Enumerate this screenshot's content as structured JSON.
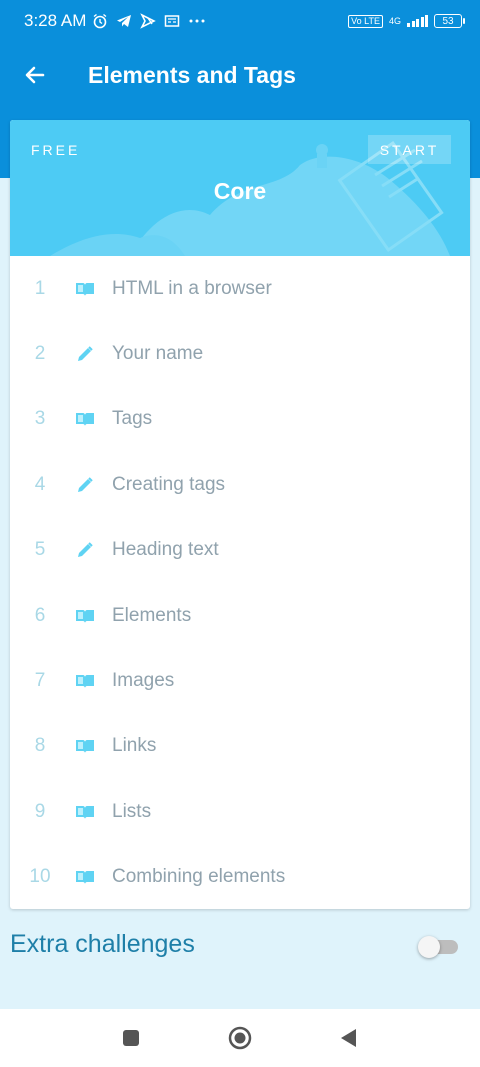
{
  "status": {
    "time": "3:28 AM",
    "icons": [
      "alarm-icon",
      "telegram-icon",
      "telegram-x-icon",
      "news-icon",
      "more-icon"
    ],
    "network_badge": "Vo LTE",
    "network_type": "4G",
    "battery": "53"
  },
  "appbar": {
    "title": "Elements and Tags",
    "back_icon": "arrow-left-icon"
  },
  "course": {
    "tag": "FREE",
    "start_label": "START",
    "title": "Core",
    "lessons": [
      {
        "num": "1",
        "label": "HTML in a browser",
        "icon": "book-icon"
      },
      {
        "num": "2",
        "label": "Your name",
        "icon": "pencil-icon"
      },
      {
        "num": "3",
        "label": "Tags",
        "icon": "book-icon"
      },
      {
        "num": "4",
        "label": "Creating tags",
        "icon": "pencil-icon"
      },
      {
        "num": "5",
        "label": "Heading text",
        "icon": "pencil-icon"
      },
      {
        "num": "6",
        "label": "Elements",
        "icon": "book-icon"
      },
      {
        "num": "7",
        "label": "Images",
        "icon": "book-icon"
      },
      {
        "num": "8",
        "label": "Links",
        "icon": "book-icon"
      },
      {
        "num": "9",
        "label": "Lists",
        "icon": "book-icon"
      },
      {
        "num": "10",
        "label": "Combining elements",
        "icon": "book-icon"
      }
    ]
  },
  "extra": {
    "label": "Extra challenges",
    "enabled": false
  },
  "navbar": {
    "icons": [
      "recents-square-icon",
      "home-circle-icon",
      "back-triangle-icon"
    ]
  },
  "colors": {
    "primary": "#0a8fdb",
    "banner": "#4dcbf4",
    "background": "#dff3fb",
    "icon_accent": "#5fd3f3",
    "label_text": "#90a2ad",
    "extra_text": "#1e7fa8"
  }
}
